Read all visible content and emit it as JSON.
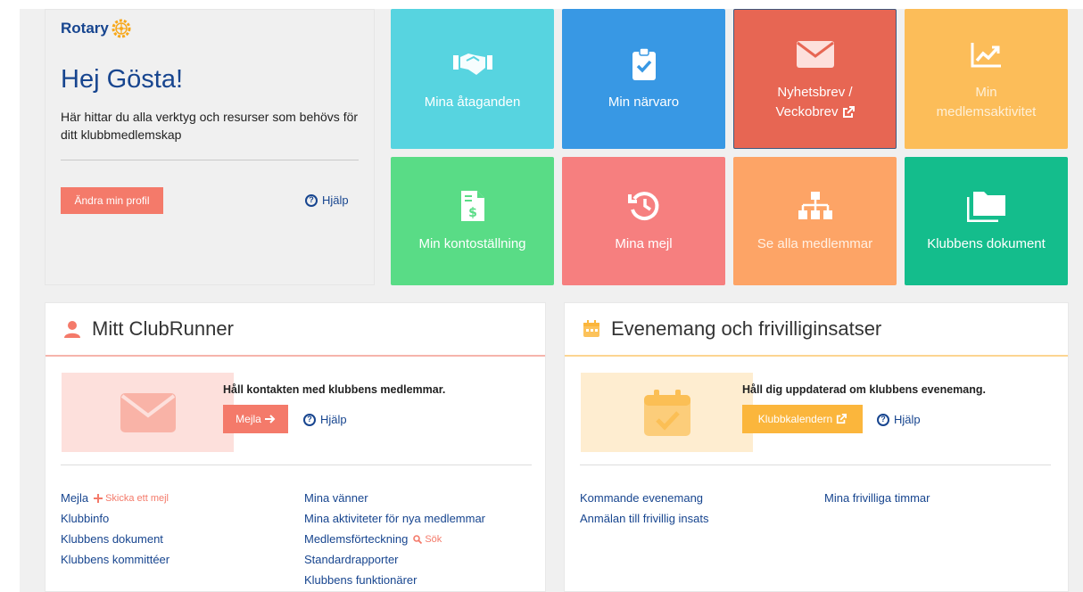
{
  "welcome": {
    "logo_text": "Rotary",
    "greeting": "Hej Gösta!",
    "description": "Här hittar du alla verktyg och resurser som behövs för ditt klubbmedlemskap",
    "profile_button": "Ändra min profil",
    "help_label": "Hjälp"
  },
  "tiles": [
    {
      "label": "Mina åtaganden",
      "icon": "handshake-icon",
      "color": "#57d4e0"
    },
    {
      "label": "Min närvaro",
      "icon": "clipboard-check-icon",
      "color": "#3898e4"
    },
    {
      "label": "Nyhetsbrev /",
      "label2": "Veckobrev",
      "icon": "envelope-icon",
      "color": "#e76653"
    },
    {
      "label": "Min",
      "label2": "medlemsaktivitet",
      "icon": "chart-line-icon",
      "color": "#fcbd59"
    },
    {
      "label": "Min kontoställning",
      "icon": "invoice-dollar-icon",
      "color": "#59dc86"
    },
    {
      "label": "Mina mejl",
      "icon": "history-icon",
      "color": "#f67f7f"
    },
    {
      "label": "Se alla medlemmar",
      "icon": "org-chart-icon",
      "color": "#fda466"
    },
    {
      "label": "Klubbens dokument",
      "icon": "folders-icon",
      "color": "#14bd8c"
    }
  ],
  "clubrunner": {
    "title": "Mitt ClubRunner",
    "promo_title": "Håll kontakten med klubbens medlemmar.",
    "mail_button": "Mejla",
    "help_label": "Hjälp",
    "links_col1": {
      "mejla": "Mejla",
      "send_mail": "Skicka ett mejl",
      "klubbinfo": "Klubbinfo",
      "dokument": "Klubbens dokument",
      "kommitteer": "Klubbens kommittéer"
    },
    "links_col2": {
      "vanner": "Mina vänner",
      "aktiviteter": "Mina aktiviteter för nya medlemmar",
      "forteckning": "Medlemsförteckning",
      "sok": "Sök",
      "rapporter": "Standardrapporter",
      "funktionarer": "Klubbens funktionärer"
    }
  },
  "events": {
    "title": "Evenemang och frivilliginsatser",
    "promo_title": "Håll dig uppdaterad om klubbens evenemang.",
    "calendar_button": "Klubbkalendern",
    "help_label": "Hjälp",
    "links_col1": {
      "kommande": "Kommande evenemang",
      "anmalan": "Anmälan till frivillig insats"
    },
    "links_col2": {
      "timmar": "Mina frivilliga timmar"
    }
  }
}
